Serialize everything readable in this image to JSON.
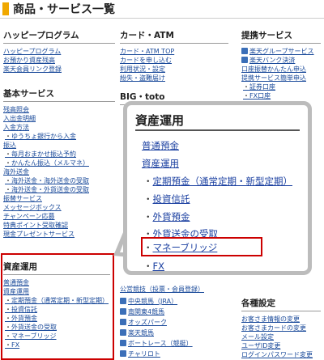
{
  "page": {
    "title": "商品・サービス一覧"
  },
  "happy": {
    "heading": "ハッピープログラム",
    "links": [
      "ハッピープログラム",
      "お預かり資産残高",
      "楽天会員リンク登録"
    ]
  },
  "card": {
    "heading": "カード・ATM",
    "links": [
      "カード・ATM TOP",
      "カードを申し込む",
      "利用状況・設定",
      "紛失・盗難届け"
    ]
  },
  "partner": {
    "heading": "提携サービス",
    "links": [
      "楽天グループサービス",
      "楽天バンク決済",
      "口座振替かんたん申込",
      "提携サービス簡単申込",
      "証券口座",
      "FX口座"
    ]
  },
  "basic": {
    "heading": "基本サービス",
    "links": [
      "残高照会",
      "入出金明細",
      "入金方法",
      "ゆうちょ銀行から入金",
      "振込",
      "毎月おまかせ振込予約",
      "かんたん振込（メルマネ）",
      "海外送金",
      "海外送金・海外送金の受取",
      "海外送金・外貨送金の受取",
      "振替サービス",
      "メッセージボックス",
      "チャンペーン応募",
      "特典ポイント受取確認",
      "現金プレゼントサービス"
    ]
  },
  "bigtoto": {
    "heading": "BIG・toto"
  },
  "asset_small": {
    "heading": "資産運用",
    "links": [
      "普通預金",
      "資産運用",
      "定期預金（通常定期・新型定期）",
      "投資信託",
      "外貨預金",
      "外貨送金の受取",
      "マネーブリッジ",
      "FX"
    ]
  },
  "lottery": {
    "links": [
      "公営競技（投票・会員登録）",
      "中央競馬（JRA）",
      "南関東4競馬",
      "オッズパーク",
      "楽天競馬",
      "ボートレース（競艇）",
      "チャリロト"
    ]
  },
  "settings": {
    "heading": "各種設定",
    "links": [
      "お客さま情報の変更",
      "お客さまカードの変更",
      "メール設定",
      "ユーザID変更",
      "ログインパスワード変更"
    ]
  },
  "callout": {
    "heading": "資産運用",
    "links": [
      "普通預金",
      "資産運用",
      "定期預金（通常定期・新型定期）",
      "投資信託",
      "外貨預金",
      "外貨送金の受取",
      "マネーブリッジ",
      "FX"
    ]
  },
  "colors": {
    "accent": "#f0a800",
    "highlight": "#c00000",
    "link": "#1a4a9a"
  }
}
